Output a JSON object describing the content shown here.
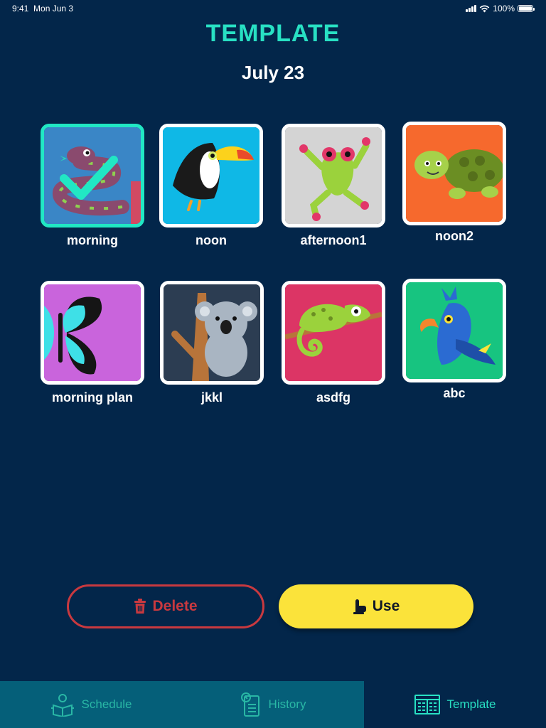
{
  "status_bar": {
    "time": "9:41",
    "date": "Mon Jun 3",
    "battery": "100%"
  },
  "header": {
    "title": "TEMPLATE",
    "date": "July 23"
  },
  "templates": [
    {
      "label": "morning",
      "icon": "snake-icon",
      "color": "#3a86c6",
      "selected": true
    },
    {
      "label": "noon",
      "icon": "toucan-icon",
      "color": "#0fb8e6",
      "selected": false
    },
    {
      "label": "afternoon1",
      "icon": "frog-icon",
      "color": "#d4d4d4",
      "selected": false
    },
    {
      "label": "noon2",
      "icon": "turtle-icon",
      "color": "#f6692d",
      "selected": false
    },
    {
      "label": "morning plan",
      "icon": "butterfly-icon",
      "color": "#c964dc",
      "selected": false
    },
    {
      "label": "jkkl",
      "icon": "koala-icon",
      "color": "#2c3d52",
      "selected": false
    },
    {
      "label": "asdfg",
      "icon": "chameleon-icon",
      "color": "#dc3565",
      "selected": false
    },
    {
      "label": "abc",
      "icon": "parrot-icon",
      "color": "#17c480",
      "selected": false
    }
  ],
  "actions": {
    "delete_label": "Delete",
    "use_label": "Use"
  },
  "tabs": [
    {
      "label": "Schedule",
      "icon": "schedule-icon",
      "active": false
    },
    {
      "label": "History",
      "icon": "history-icon",
      "active": false
    },
    {
      "label": "Template",
      "icon": "template-icon",
      "active": true
    }
  ],
  "colors": {
    "accent": "#28e0c3",
    "background": "#03264a",
    "delete": "#c9393f",
    "use": "#fbe33a",
    "tab_inactive": "#055f79"
  }
}
